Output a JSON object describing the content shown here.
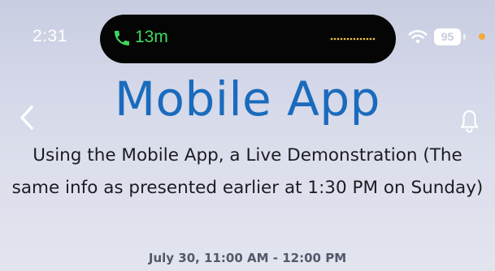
{
  "status_bar": {
    "time": "2:31",
    "call_duration": "13m",
    "battery_level": "95",
    "call_color": "#3fd75f",
    "privacy_dot_color": "#f5a93b",
    "icons": [
      "phone-icon",
      "waveform-icon",
      "wifi-icon",
      "battery-icon"
    ]
  },
  "header": {
    "overlay_title": "Mobile App",
    "overlay_color": "#1a6bbd",
    "icons": [
      "back-chevron-icon",
      "bell-icon"
    ]
  },
  "event": {
    "title": "Using the Mobile App, a Live Demonstration (The same info as presented earlier at 1:30 PM on Sunday)",
    "time": "July 30, 11:00 AM - 12:00 PM"
  }
}
